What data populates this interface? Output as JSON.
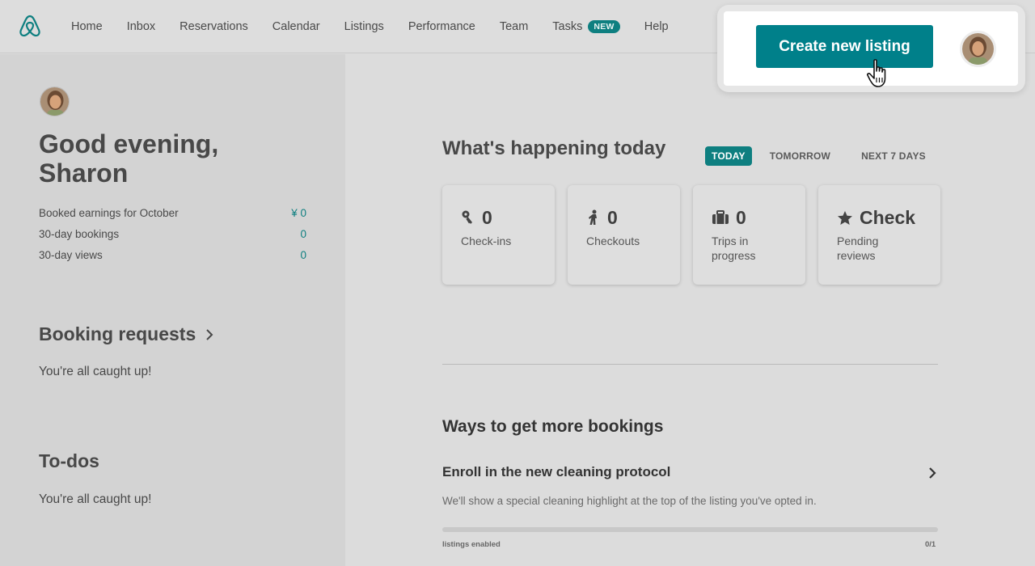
{
  "nav": {
    "items": [
      "Home",
      "Inbox",
      "Reservations",
      "Calendar",
      "Listings",
      "Performance",
      "Team"
    ],
    "tasks_label": "Tasks",
    "tasks_badge": "NEW",
    "help_label": "Help"
  },
  "create": {
    "button_label": "Create new listing"
  },
  "greeting": {
    "line1": "Good evening,",
    "line2": "Sharon"
  },
  "stats": [
    {
      "label": "Booked earnings for October",
      "value": "¥ 0"
    },
    {
      "label": "30-day bookings",
      "value": "0"
    },
    {
      "label": "30-day views",
      "value": "0"
    }
  ],
  "booking_requests": {
    "title": "Booking requests",
    "status": "You're all caught up!"
  },
  "todos": {
    "title": "To-dos",
    "status": "You're all caught up!"
  },
  "happening": {
    "title": "What's happening today",
    "tabs": [
      "TODAY",
      "TOMORROW",
      "NEXT 7 DAYS"
    ],
    "active_tab": "TODAY",
    "cards": [
      {
        "icon": "key-icon",
        "value": "0",
        "label": "Check-ins"
      },
      {
        "icon": "person-walking-icon",
        "value": "0",
        "label": "Checkouts"
      },
      {
        "icon": "suitcase-icon",
        "value": "0",
        "label": "Trips in progress"
      },
      {
        "icon": "star-icon",
        "value": "Check",
        "label": "Pending reviews"
      }
    ]
  },
  "ways": {
    "title": "Ways to get more bookings",
    "item_title": "Enroll in the new cleaning protocol",
    "item_desc": "We'll show a special cleaning highlight at the top of the listing you've opted in.",
    "progress_label": "listings enabled",
    "progress_count": "0/1",
    "progress_fraction": 0
  },
  "colors": {
    "accent": "#0e7f80",
    "button": "#00808a"
  }
}
